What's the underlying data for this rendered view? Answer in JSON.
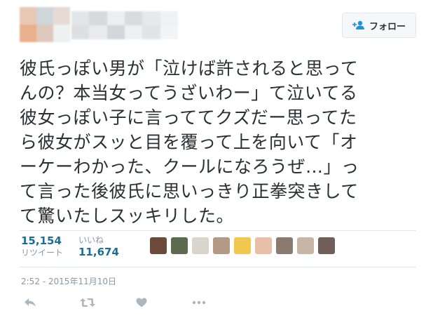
{
  "header": {
    "follow_label": "フォロー",
    "avatar_colors": [
      "#e8c7b4",
      "#cfd6da",
      "#e7dad3",
      "#e8b08c",
      "#dfc9bd",
      "#eef0f1"
    ],
    "name_colors": [
      "#e3e6e8",
      "#d6dadd",
      "#eceeef",
      "#d9dcdf",
      "#e6e8ea",
      "#f0f1f2",
      "#dde0e3",
      "#e9ebec",
      "#d3d7da",
      "#eef0f1",
      "#e1e4e6",
      "#f3f4f5"
    ]
  },
  "tweet": {
    "lines": [
      "彼氏っぽい男が「泣けば許されると思って",
      "んの？本当女ってうざいわー」て泣いてる",
      "彼女っぽい子に言っててクズだー思ってた",
      "ら彼女がスッと目を覆って上を向いて「オ",
      "ーケーわかった、クールになろうぜ…」っ",
      "て言った後彼氏に思いっきり正拳突きして",
      "て驚いたしスッキリした。"
    ]
  },
  "stats": {
    "retweets": "15,154",
    "retweets_label": "リツイート",
    "likes": "11,674",
    "likes_label": "いいね"
  },
  "likers": [
    {
      "icon": "user-avatar-1",
      "color": "#6b4a3a"
    },
    {
      "icon": "user-avatar-2",
      "color": "#5c6b4f"
    },
    {
      "icon": "user-avatar-3",
      "color": "#d9d4cc"
    },
    {
      "icon": "user-avatar-4",
      "color": "#b39a86"
    },
    {
      "icon": "user-avatar-5",
      "color": "#f0c850"
    },
    {
      "icon": "user-avatar-6",
      "color": "#e8c0a8"
    },
    {
      "icon": "user-avatar-7",
      "color": "#8a7a70"
    },
    {
      "icon": "user-avatar-8",
      "color": "#c7b6a5"
    },
    {
      "icon": "user-avatar-9",
      "color": "#6f5e5a"
    }
  ],
  "timestamp": "2:52 - 2015年11月10日",
  "colors": {
    "accent": "#1b6e98",
    "muted": "#8899a6",
    "icon": "#aab8c2"
  }
}
